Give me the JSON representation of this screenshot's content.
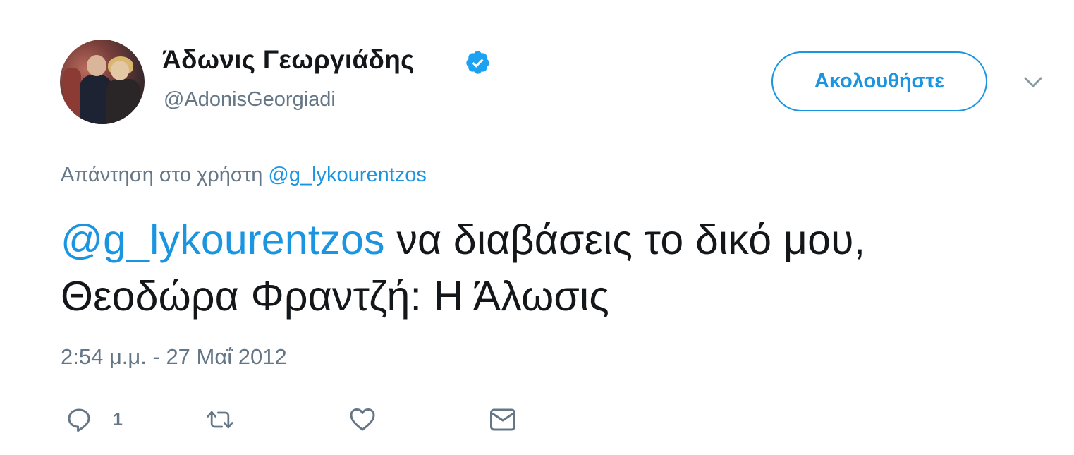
{
  "user": {
    "display_name": "Άδωνις Γεωργιάδης",
    "handle": "@AdonisGeorgiadi",
    "verified": true
  },
  "follow_button": {
    "label": "Ακολουθήστε"
  },
  "reply_context": {
    "prefix": "Απάντηση στο χρήστη ",
    "mention": "@g_lykourentzos"
  },
  "tweet": {
    "mention": "@g_lykourentzos",
    "text_line1_rest": " να διαβάσεις το δικό μου,",
    "text_line2": "Θεοδώρα Φραντζή: Η Άλωσις",
    "timestamp": "2:54 μ.μ. - 27 Μαΐ 2012"
  },
  "actions": {
    "reply_count": "1"
  },
  "icons": {
    "verified": "verified-badge-icon",
    "more": "chevron-down-icon",
    "reply": "reply-icon",
    "retweet": "retweet-icon",
    "like": "heart-icon",
    "message": "envelope-icon"
  },
  "colors": {
    "accent": "#1b95e0",
    "muted": "#657786",
    "text": "#14171a"
  }
}
